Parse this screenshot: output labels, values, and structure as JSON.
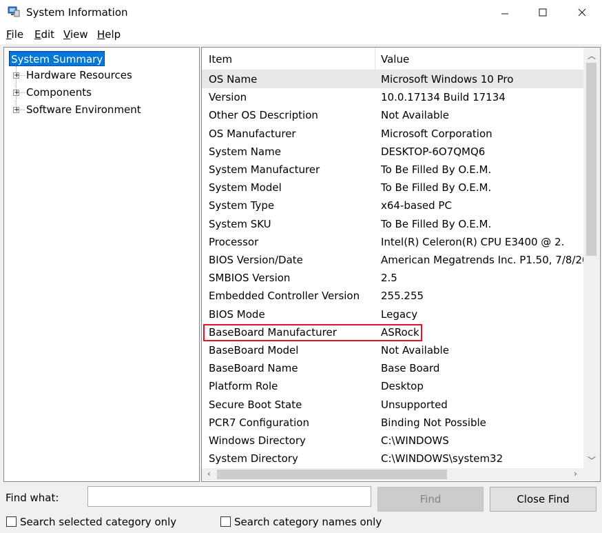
{
  "window": {
    "title": "System Information",
    "app_icon": "system-info-icon",
    "minimize_icon": "minimize-icon",
    "maximize_icon": "maximize-icon",
    "close_icon": "close-icon"
  },
  "menu": [
    {
      "label": "File",
      "accel": "F",
      "rest": "ile"
    },
    {
      "label": "Edit",
      "accel": "E",
      "rest": "dit"
    },
    {
      "label": "View",
      "accel": "V",
      "rest": "iew"
    },
    {
      "label": "Help",
      "accel": "H",
      "rest": "elp"
    }
  ],
  "tree": {
    "selected": "System Summary",
    "children": [
      "Hardware Resources",
      "Components",
      "Software Environment"
    ],
    "expand_glyph": "+"
  },
  "list": {
    "columns": [
      "Item",
      "Value"
    ],
    "rows": [
      [
        "OS Name",
        "Microsoft Windows 10 Pro"
      ],
      [
        "Version",
        "10.0.17134 Build 17134"
      ],
      [
        "Other OS Description",
        "Not Available"
      ],
      [
        "OS Manufacturer",
        "Microsoft Corporation"
      ],
      [
        "System Name",
        "DESKTOP-6O7QMQ6"
      ],
      [
        "System Manufacturer",
        "To Be Filled By O.E.M."
      ],
      [
        "System Model",
        "To Be Filled By O.E.M."
      ],
      [
        "System Type",
        "x64-based PC"
      ],
      [
        "System SKU",
        "To Be Filled By O.E.M."
      ],
      [
        "Processor",
        "Intel(R) Celeron(R) CPU        E3400  @ 2."
      ],
      [
        "BIOS Version/Date",
        "American Megatrends Inc. P1.50, 7/8/20"
      ],
      [
        "SMBIOS Version",
        "2.5"
      ],
      [
        "Embedded Controller Version",
        "255.255"
      ],
      [
        "BIOS Mode",
        "Legacy"
      ],
      [
        "BaseBoard Manufacturer",
        "ASRock"
      ],
      [
        "BaseBoard Model",
        "Not Available"
      ],
      [
        "BaseBoard Name",
        "Base Board"
      ],
      [
        "Platform Role",
        "Desktop"
      ],
      [
        "Secure Boot State",
        "Unsupported"
      ],
      [
        "PCR7 Configuration",
        "Binding Not Possible"
      ],
      [
        "Windows Directory",
        "C:\\WINDOWS"
      ],
      [
        "System Directory",
        "C:\\WINDOWS\\system32"
      ]
    ],
    "highlighted_row": "BaseBoard Manufacturer",
    "highlight_color": "#e81123",
    "selection_color": "#0078d7"
  },
  "find": {
    "label": "Find what:",
    "value": "",
    "find_button": "Find",
    "close_find_button": "Close Find",
    "search_selected_label": "Search selected category only",
    "search_names_label": "Search category names only"
  }
}
